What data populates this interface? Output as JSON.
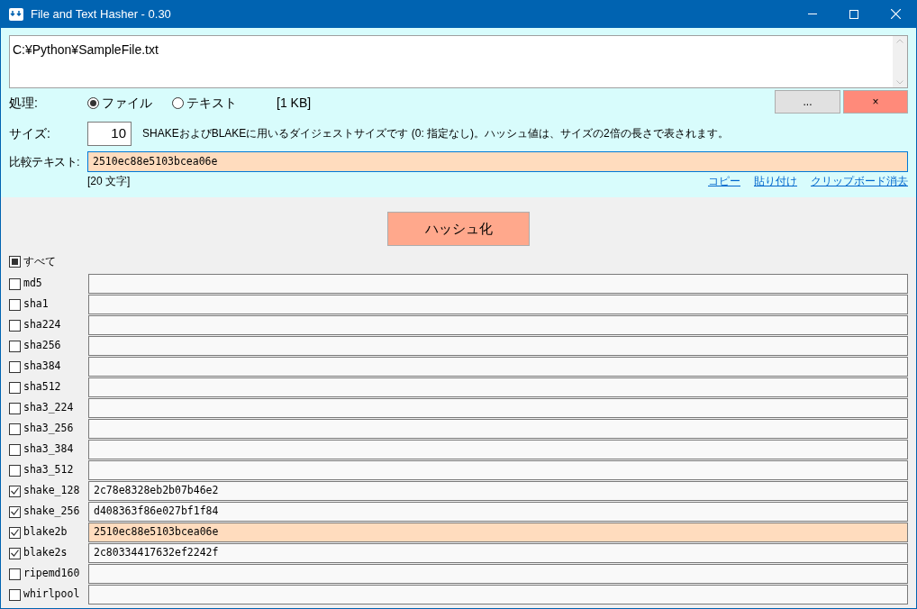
{
  "window": {
    "title": "File and Text Hasher - 0.30"
  },
  "input_text": {
    "value": "C:¥Python¥SampleFile.txt"
  },
  "mode": {
    "label": "処理:",
    "options": [
      {
        "label": "ファイル",
        "selected": true
      },
      {
        "label": "テキスト",
        "selected": false
      }
    ],
    "size_info": "[1 KB]"
  },
  "buttons": [
    {
      "kind": "browse",
      "label": "..."
    },
    {
      "kind": "clear",
      "label": "×"
    }
  ],
  "size": {
    "label": "サイズ:",
    "value": "10",
    "description": "SHAKEおよびBLAKEに用いるダイジェストサイズです (0: 指定なし)。ハッシュ値は、サイズの2倍の長さで表されます。"
  },
  "compare": {
    "label": "比較テキスト:",
    "value": "2510ec88e5103bcea06e",
    "count": "[20 文字]",
    "links": [
      "コピー",
      "貼り付け",
      "クリップボード消去"
    ]
  },
  "hash_button": {
    "label": "ハッシュ化"
  },
  "select_all": {
    "label": "すべて",
    "indeterminate": true
  },
  "algorithms": [
    {
      "name": "md5",
      "checked": false,
      "match": false
    },
    {
      "name": "sha1",
      "checked": false,
      "match": false
    },
    {
      "name": "sha224",
      "checked": false,
      "match": false
    },
    {
      "name": "sha256",
      "checked": false,
      "match": false
    },
    {
      "name": "sha384",
      "checked": false,
      "match": false
    },
    {
      "name": "sha512",
      "checked": false,
      "match": false
    },
    {
      "name": "sha3_224",
      "checked": false,
      "match": false
    },
    {
      "name": "sha3_256",
      "checked": false,
      "match": false
    },
    {
      "name": "sha3_384",
      "checked": false,
      "match": false
    },
    {
      "name": "sha3_512",
      "checked": false,
      "match": false
    },
    {
      "name": "shake_128",
      "checked": true,
      "value": "2c78e8328eb2b07b46e2",
      "match": false
    },
    {
      "name": "shake_256",
      "checked": true,
      "value": "d408363f86e027bf1f84",
      "match": false
    },
    {
      "name": "blake2b",
      "checked": true,
      "value": "2510ec88e5103bcea06e",
      "match": true
    },
    {
      "name": "blake2s",
      "checked": true,
      "value": "2c80334417632ef2242f",
      "match": false
    },
    {
      "name": "ripemd160",
      "checked": false,
      "match": false
    },
    {
      "name": "whirlpool",
      "checked": false,
      "match": false
    }
  ]
}
